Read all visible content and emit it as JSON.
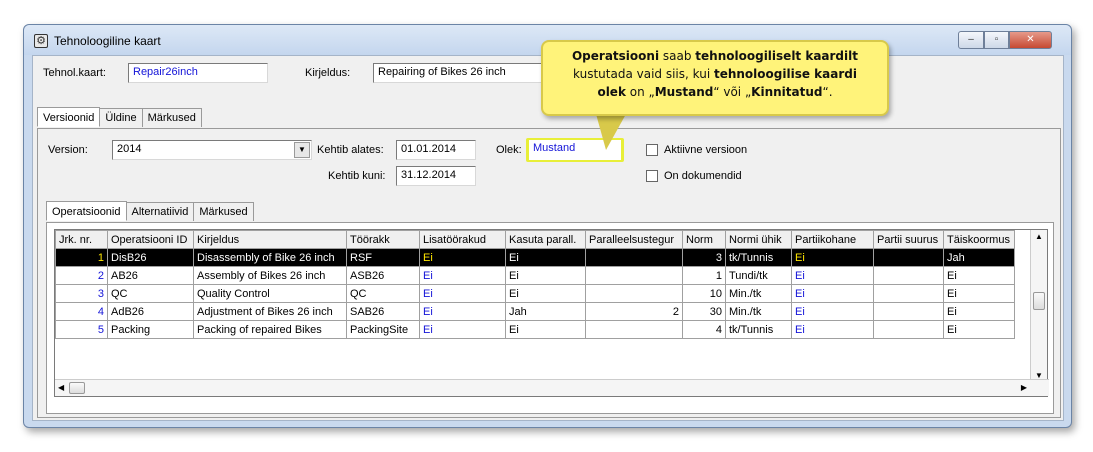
{
  "window": {
    "title": "Tehnoloogiline kaart",
    "buttons": {
      "minimize": "–",
      "maximize": "▫",
      "close": "✕"
    }
  },
  "header": {
    "tehnol_label": "Tehnol.kaart:",
    "tehnol_value": "Repair26inch",
    "kirjeldus_label": "Kirjeldus:",
    "kirjeldus_value": "Repairing of Bikes 26 inch"
  },
  "top_tabs": [
    "Versioonid",
    "Üldine",
    "Märkused"
  ],
  "version": {
    "version_label": "Version:",
    "version_value": "2014",
    "kehtib_alates_label": "Kehtib alates:",
    "kehtib_alates_value": "01.01.2014",
    "kehtib_kuni_label": "Kehtib kuni:",
    "kehtib_kuni_value": "31.12.2014",
    "olek_label": "Olek:",
    "olek_value": "Mustand",
    "aktiivne_label": "Aktiivne versioon",
    "dokumendid_label": "On dokumendid"
  },
  "inner_tabs": [
    "Operatsioonid",
    "Alternatiivid",
    "Märkused"
  ],
  "grid": {
    "columns": [
      "Jrk. nr.",
      "Operatsiooni ID",
      "Kirjeldus",
      "Töörakk",
      "Lisatöörakud",
      "Kasuta parall.",
      "Paralleelsustegur",
      "Norm",
      "Normi ühik",
      "Partiikohane",
      "Partii suurus",
      "Täiskoormus"
    ],
    "rows": [
      [
        "1",
        "DisB26",
        "Disassembly of Bike 26 inch",
        "RSF",
        "Ei",
        "Ei",
        "",
        "3",
        "tk/Tunnis",
        "Ei",
        "",
        "Jah"
      ],
      [
        "2",
        "AB26",
        "Assembly of Bikes 26 inch",
        "ASB26",
        "Ei",
        "Ei",
        "",
        "1",
        "Tundi/tk",
        "Ei",
        "",
        "Ei"
      ],
      [
        "3",
        "QC",
        "Quality Control",
        "QC",
        "Ei",
        "Ei",
        "",
        "10",
        "Min./tk",
        "Ei",
        "",
        "Ei"
      ],
      [
        "4",
        "AdB26",
        "Adjustment of Bikes 26 inch",
        "SAB26",
        "Ei",
        "Jah",
        "2",
        "30",
        "Min./tk",
        "Ei",
        "",
        "Ei"
      ],
      [
        "5",
        "Packing",
        "Packing of repaired Bikes",
        "PackingSite",
        "Ei",
        "Ei",
        "",
        "4",
        "tk/Tunnis",
        "Ei",
        "",
        "Ei"
      ]
    ]
  },
  "callout": {
    "b1": "Operatsiooni",
    "t1": " saab ",
    "b2": "tehnoloogiliselt kaardilt",
    "t2": "kustutada vaid siis, kui ",
    "b3": "tehnoloogilise kaardi",
    "b4": "olek",
    "t3": " on „",
    "b5": "Mustand",
    "t4": "“ või „",
    "b6": "Kinnitatud",
    "t5": "“."
  },
  "colors": {
    "callout_bg": "#fff37a",
    "highlight": "#e8ef38",
    "link_blue": "#1414d8",
    "selected_row": "#000000"
  }
}
